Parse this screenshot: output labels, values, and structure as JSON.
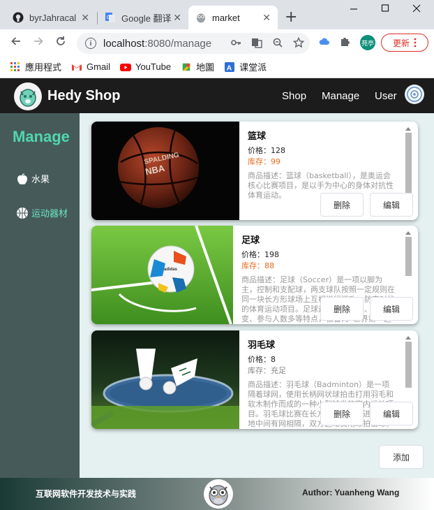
{
  "browser": {
    "tabs": [
      {
        "title": "byrJahracal"
      },
      {
        "title": "Google 翻译"
      },
      {
        "title": "market"
      }
    ],
    "close_glyph": "✕",
    "new_tab_glyph": "+",
    "url_host": "localhost",
    "url_path": ":8080/manage",
    "profile_label": "苑亭",
    "update_label": "更新",
    "bookmarks": [
      {
        "label": "應用程式",
        "icon": "apps-grid-icon"
      },
      {
        "label": "Gmail",
        "icon": "gmail-icon"
      },
      {
        "label": "YouTube",
        "icon": "youtube-icon"
      },
      {
        "label": "地圖",
        "icon": "maps-icon"
      },
      {
        "label": "课堂派",
        "icon": "ketangpai-icon"
      }
    ]
  },
  "header": {
    "brand": "Hedy Shop",
    "nav": [
      "Shop",
      "Manage",
      "User"
    ]
  },
  "sidebar": {
    "title": "Manage",
    "items": [
      {
        "label": "水果",
        "icon": "apple-icon",
        "active": false
      },
      {
        "label": "运动器材",
        "icon": "basketball-icon",
        "active": true
      }
    ]
  },
  "products": [
    {
      "name": "篮球",
      "price_label": "价格：",
      "price": "128",
      "stock_label": "库存：",
      "stock": "99",
      "desc_label": "商品描述：",
      "desc": "篮球（basketball），是奥运会核心比赛项目，是以手为中心的身体对抗性体育运动。",
      "image": "basketball-photo"
    },
    {
      "name": "足球",
      "price_label": "价格：",
      "price": "198",
      "stock_label": "库存：",
      "stock": "88",
      "desc_label": "商品描述：",
      "desc": "足球（Soccer）是一项以脚为主，控制和支配球，两支球队按照一定规则在同一块长方形球场上互相进行进攻、防守对抗的体育运动项目。足球运动对抗性强、战术多变、参与人数多等特点，被誉为“世界第一运动”。",
      "image": "soccer-photo"
    },
    {
      "name": "羽毛球",
      "price_label": "价格：",
      "price": "8",
      "stock_label": "库存：",
      "stock": "充足",
      "desc_label": "商品描述：",
      "desc": "羽毛球（Badminton）是一项隔着球网，使用长柄网状球拍击打用羽毛和软木制作而成的一种小型球类的室内运动项目。羽毛球比赛在长方形的场地上进行，场地中间有网相隔，双方运动员用球拍击球，击球和扑球技战术，将球从网上打到对方场区。",
      "image": "badminton-photo"
    }
  ],
  "buttons": {
    "delete": "删除",
    "edit": "编辑",
    "add": "添加"
  },
  "footer": {
    "left": "互联网软件开发技术与实践",
    "right": "Author: Yuanheng Wang"
  },
  "colors": {
    "accent": "#4fd7b0",
    "sidebar": "#465a5a",
    "header": "#1c1c1c",
    "stock_low": "#e86a1c"
  }
}
